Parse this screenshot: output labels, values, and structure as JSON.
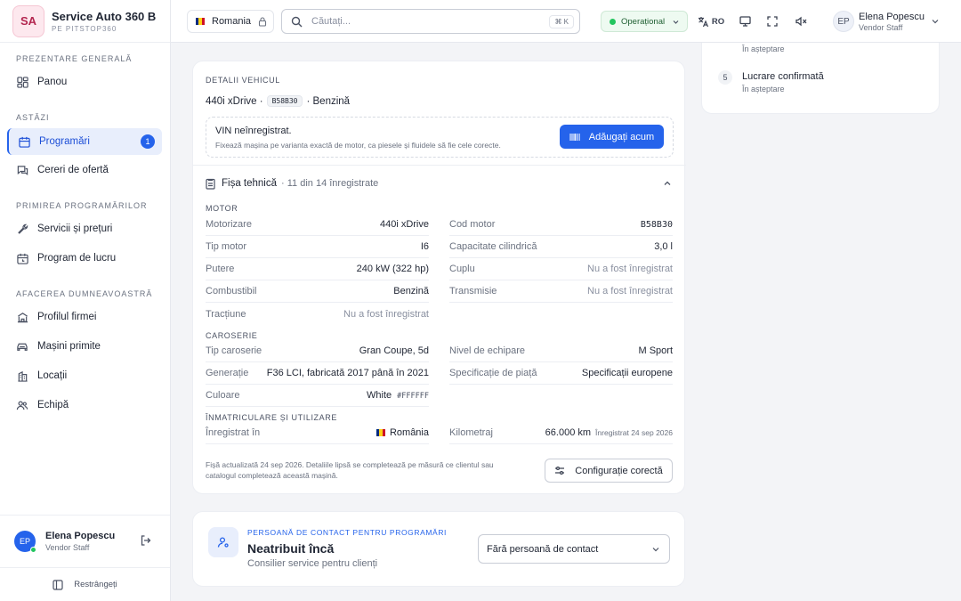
{
  "brand": {
    "initials": "SA",
    "name": "Service Auto 360 B…",
    "sub": "PE PITSTOP360"
  },
  "nav": {
    "sections": [
      "PREZENTARE GENERALĂ",
      "ASTĂZI",
      "PRIMIREA PROGRAMĂRILOR",
      "AFACEREA DUMNEAVOASTRĂ"
    ],
    "items": [
      {
        "label": "Panou",
        "icon": "dashboard-icon"
      },
      {
        "label": "Programări",
        "icon": "calendar-icon",
        "badge": "1"
      },
      {
        "label": "Cereri de ofertă",
        "icon": "chat-icon"
      },
      {
        "label": "Servicii și prețuri",
        "icon": "wrench-icon"
      },
      {
        "label": "Program de lucru",
        "icon": "clock-icon"
      },
      {
        "label": "Profilul firmei",
        "icon": "building-icon"
      },
      {
        "label": "Mașini primite",
        "icon": "car-icon"
      },
      {
        "label": "Locații",
        "icon": "location-icon"
      },
      {
        "label": "Echipă",
        "icon": "team-icon"
      }
    ],
    "collapse_label": "Restrângeți"
  },
  "user": {
    "initials": "EP",
    "name": "Elena Popescu",
    "role": "Vendor Staff"
  },
  "topbar": {
    "country": "Romania",
    "search_placeholder": "Căutați...",
    "shortcut": "⌘ K",
    "status": "Operațional",
    "language": "RO",
    "flag_colors": [
      "#002b7f",
      "#fcd116",
      "#ce1126"
    ],
    "status_color": "#22c55e",
    "accent": "#2563eb"
  },
  "timeline": [
    {
      "num": "5",
      "title": "Lucrare confirmată",
      "status": "În așteptare"
    }
  ],
  "timeline_prev_status": "În așteptare",
  "vehicle": {
    "section_label": "DETALII VEHICUL",
    "model": "440i xDrive",
    "engine_code_chip": "B58B30",
    "fuel": "Benzină",
    "vin_title": "VIN neînregistrat.",
    "vin_desc": "Fixează mașina pe varianta exactă de motor, ca piesele și fluidele să fie cele corecte.",
    "vin_button": "Adăugați acum",
    "sheet_title": "Fișa tehnică",
    "sheet_count": "· 11 din 14 înregistrate",
    "groups": {
      "motor": "MOTOR",
      "body": "CAROSERIE",
      "reg": "ÎNMATRICULARE ȘI UTILIZARE"
    },
    "motor_left": [
      {
        "k": "Motorizare",
        "v": "440i xDrive"
      },
      {
        "k": "Tip motor",
        "v": "I6"
      },
      {
        "k": "Putere",
        "v": "240 kW (322 hp)"
      },
      {
        "k": "Combustibil",
        "v": "Benzină"
      },
      {
        "k": "Tracțiune",
        "v": "Nu a fost înregistrat"
      }
    ],
    "motor_right": [
      {
        "k": "Cod motor",
        "v": "B58B30"
      },
      {
        "k": "Capacitate cilindrică",
        "v": "3,0 l"
      },
      {
        "k": "Cuplu",
        "v": "Nu a fost înregistrat"
      },
      {
        "k": "Transmisie",
        "v": "Nu a fost înregistrat"
      }
    ],
    "body_left": [
      {
        "k": "Tip caroserie",
        "v": "Gran Coupe, 5d"
      },
      {
        "k": "Generație",
        "v": "F36 LCI, fabricată 2017 până în 2021"
      },
      {
        "k": "Culoare",
        "v": "White",
        "extra": "#FFFFFF"
      }
    ],
    "body_right": [
      {
        "k": "Nivel de echipare",
        "v": "M Sport"
      },
      {
        "k": "Specificație de piață",
        "v": "Specificații europene"
      }
    ],
    "reg_left": {
      "k": "Înregistrat în",
      "v": "România"
    },
    "reg_right": {
      "k": "Kilometraj",
      "v": "66.000 km",
      "extra": "Înregistrat 24 sep 2026"
    },
    "footer_note": "Fișă actualizată 24 sep 2026. Detaliile lipsă se completează pe măsură ce clientul sau catalogul completează această mașină.",
    "footer_button": "Configurație corectă"
  },
  "contact": {
    "label": "PERSOANĂ DE CONTACT PENTRU PROGRAMĂRI",
    "title": "Neatribuit încă",
    "subtitle": "Consilier service pentru clienți",
    "select_value": "Fără persoană de contact"
  }
}
